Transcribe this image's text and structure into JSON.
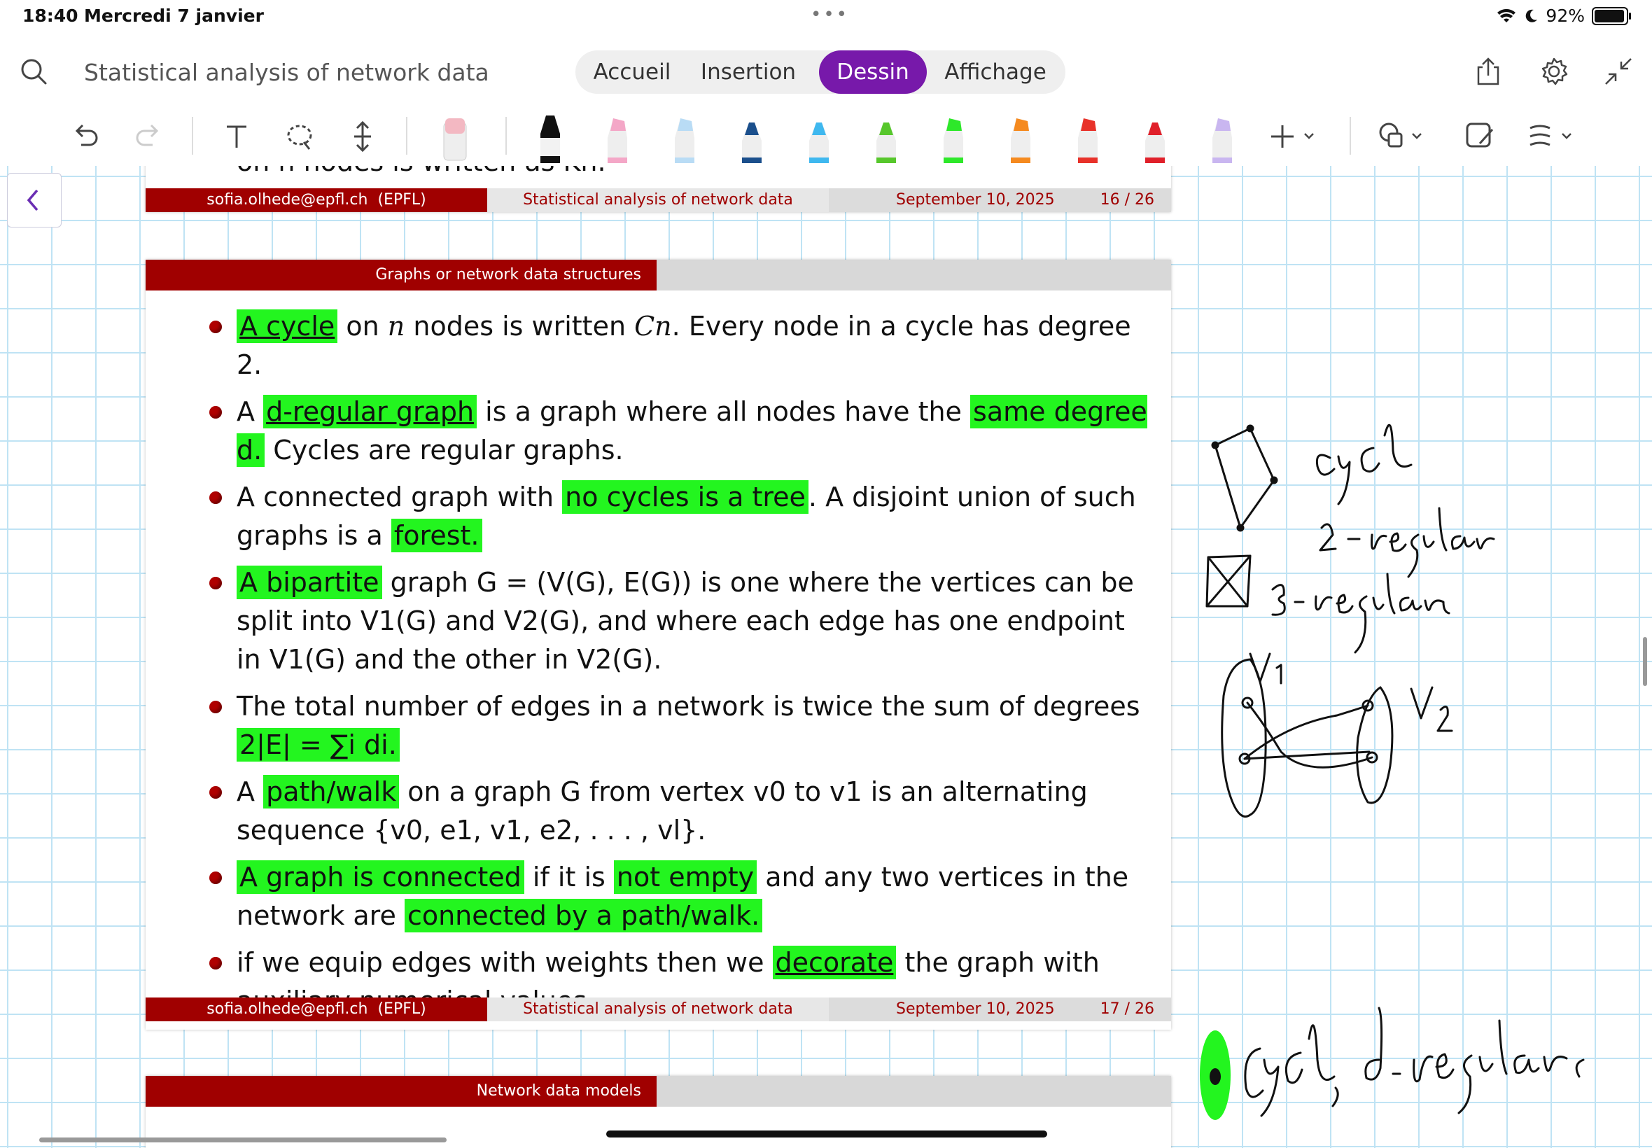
{
  "status_bar": {
    "time": "18:40",
    "date": "Mercredi 7 janvier",
    "dots": "•••",
    "battery": "92%"
  },
  "top_bar": {
    "document_title": "Statistical analysis of network data",
    "tabs": [
      {
        "label": "Accueil"
      },
      {
        "label": "Insertion"
      },
      {
        "label": "Dessin",
        "active": true
      },
      {
        "label": "Affichage"
      }
    ]
  },
  "toolbar": {
    "pens": [
      {
        "name": "eraser",
        "color": "#f3b8c2"
      },
      {
        "name": "black-pen",
        "color": "#111111"
      },
      {
        "name": "pink-highlighter",
        "color": "#f4a7c7"
      },
      {
        "name": "lightblue-highlighter",
        "color": "#b9dcf5"
      },
      {
        "name": "navy-pen",
        "color": "#1b4f8c"
      },
      {
        "name": "skyblue-pen",
        "color": "#3fb8ef"
      },
      {
        "name": "green-pen",
        "color": "#57c72c"
      },
      {
        "name": "green-highlighter",
        "color": "#2ee82a"
      },
      {
        "name": "orange-highlighter",
        "color": "#f58a1f"
      },
      {
        "name": "red-highlighter",
        "color": "#e8322a"
      },
      {
        "name": "red-pen",
        "color": "#e0202a"
      },
      {
        "name": "lavender-highlighter",
        "color": "#c9b6f0"
      }
    ],
    "highlight_color": "#23f51f"
  },
  "slide_prev_footer": {
    "author": "sofia.olhede@epfl.ch",
    "institution": "(EPFL)",
    "title": "Statistical analysis of network data",
    "date": "September 10, 2025",
    "page": "16 / 26",
    "clipped_text": "on n nodes is written as Kn."
  },
  "slide": {
    "section": "Graphs or network data structures",
    "bullets": [
      {
        "segments": [
          {
            "t": "A cycle",
            "hl": true,
            "u": true
          },
          {
            "t": " on "
          },
          {
            "t": "n",
            "math": true
          },
          {
            "t": " nodes is written "
          },
          {
            "t": "Cn",
            "math": true
          },
          {
            "t": ". Every node in a cycle has degree 2."
          }
        ]
      },
      {
        "segments": [
          {
            "t": "A "
          },
          {
            "t": "d-regular graph",
            "hl": true,
            "u": true
          },
          {
            "t": " is a graph where all nodes have the "
          },
          {
            "t": "same degree d.",
            "hl": true
          },
          {
            "t": " Cycles are regular graphs."
          }
        ]
      },
      {
        "segments": [
          {
            "t": "A connected graph with "
          },
          {
            "t": "no cycles is a tree",
            "hl": true
          },
          {
            "t": ". A disjoint union of such graphs is a "
          },
          {
            "t": "forest.",
            "hl": true
          }
        ]
      },
      {
        "segments": [
          {
            "t": "A bipartite",
            "hl": true
          },
          {
            "t": " graph G = (V(G), E(G)) is one where the vertices can be split into V1(G) and V2(G), and where each edge has one endpoint in V1(G) and the other in V2(G)."
          }
        ]
      },
      {
        "segments": [
          {
            "t": "The total number of edges in a network is twice the sum of degrees "
          },
          {
            "t": "2|E| = ∑i di.",
            "hl": true
          }
        ]
      },
      {
        "segments": [
          {
            "t": "A "
          },
          {
            "t": "path/walk",
            "hl": true
          },
          {
            "t": " on a graph G from vertex v0 to v1 is an alternating sequence {v0, e1, v1, e2, . . . , vl}."
          }
        ]
      },
      {
        "segments": [
          {
            "t": "A graph is connected",
            "hl": true
          },
          {
            "t": " if it is "
          },
          {
            "t": "not empty",
            "hl": true
          },
          {
            "t": " and any two vertices in the network are "
          },
          {
            "t": "connected by a path/walk.",
            "hl": true
          }
        ]
      },
      {
        "segments": [
          {
            "t": "if we equip edges with weights then we "
          },
          {
            "t": "decorate",
            "hl": true,
            "u": true
          },
          {
            "t": " the graph with auxiliary numerical values."
          }
        ]
      }
    ],
    "footer": {
      "author": "sofia.olhede@epfl.ch",
      "institution": "(EPFL)",
      "title": "Statistical analysis of network data",
      "date": "September 10, 2025",
      "page": "17 / 26"
    }
  },
  "slide_next": {
    "section": "Network data models"
  }
}
